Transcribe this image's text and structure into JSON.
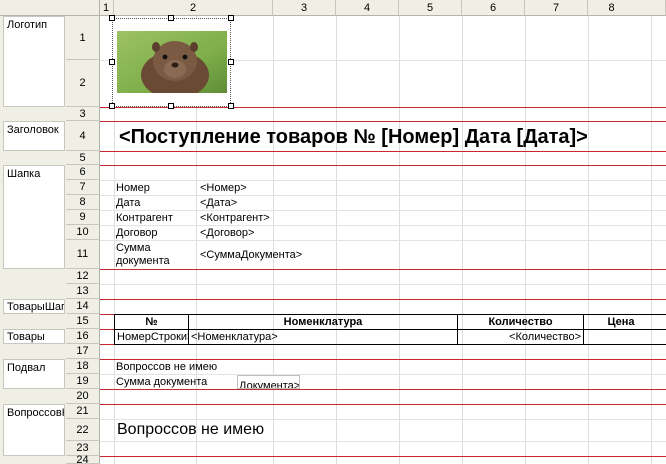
{
  "column_headers": [
    "1",
    "2",
    "3",
    "4",
    "5",
    "6",
    "7",
    "8"
  ],
  "row_numbers": [
    "1",
    "2",
    "3",
    "4",
    "5",
    "6",
    "7",
    "8",
    "9",
    "10",
    "11",
    "12",
    "13",
    "14",
    "15",
    "16",
    "17",
    "18",
    "19",
    "20",
    "21",
    "22",
    "23",
    "24"
  ],
  "groups": {
    "logo": "Логотип",
    "title": "Заголовок",
    "header": "Шапка",
    "goods_header": "ТоварыШапка",
    "goods": "Товары",
    "footer": "Подвал",
    "questions": "ВопроссовНет"
  },
  "image": {
    "name": "marmot-photo-icon",
    "colors": {
      "sky": "#7fae4a",
      "fur": "#6a4a34",
      "face": "#8a6a52"
    }
  },
  "document_title": "<Поступление товаров № [Номер] Дата [Дата]>",
  "header_fields": [
    {
      "label": "Номер",
      "value": "<Номер>"
    },
    {
      "label": "Дата",
      "value": "<Дата>"
    },
    {
      "label": "Контрагент",
      "value": "<Контрагент>"
    },
    {
      "label": "Договор",
      "value": "<Договор>"
    },
    {
      "label": "Сумма документа",
      "value": "<СуммаДокумента>"
    }
  ],
  "header_sum_label_line1": "Сумма",
  "header_sum_label_line2": "документа",
  "table": {
    "headers": [
      "№",
      "Номенклатура",
      "Количество",
      "Цена"
    ],
    "row": [
      "НомерСтроки>",
      "<Номенклатура>",
      "<Количество>",
      ""
    ]
  },
  "footer": {
    "line1": "Вопроссов не имею",
    "line2_label": "Сумма документа",
    "line2_value": "Документа>"
  },
  "questions_text": "Вопроссов не имею",
  "colors": {
    "accent": "#c8292f",
    "header_bg": "#f0efe6"
  }
}
